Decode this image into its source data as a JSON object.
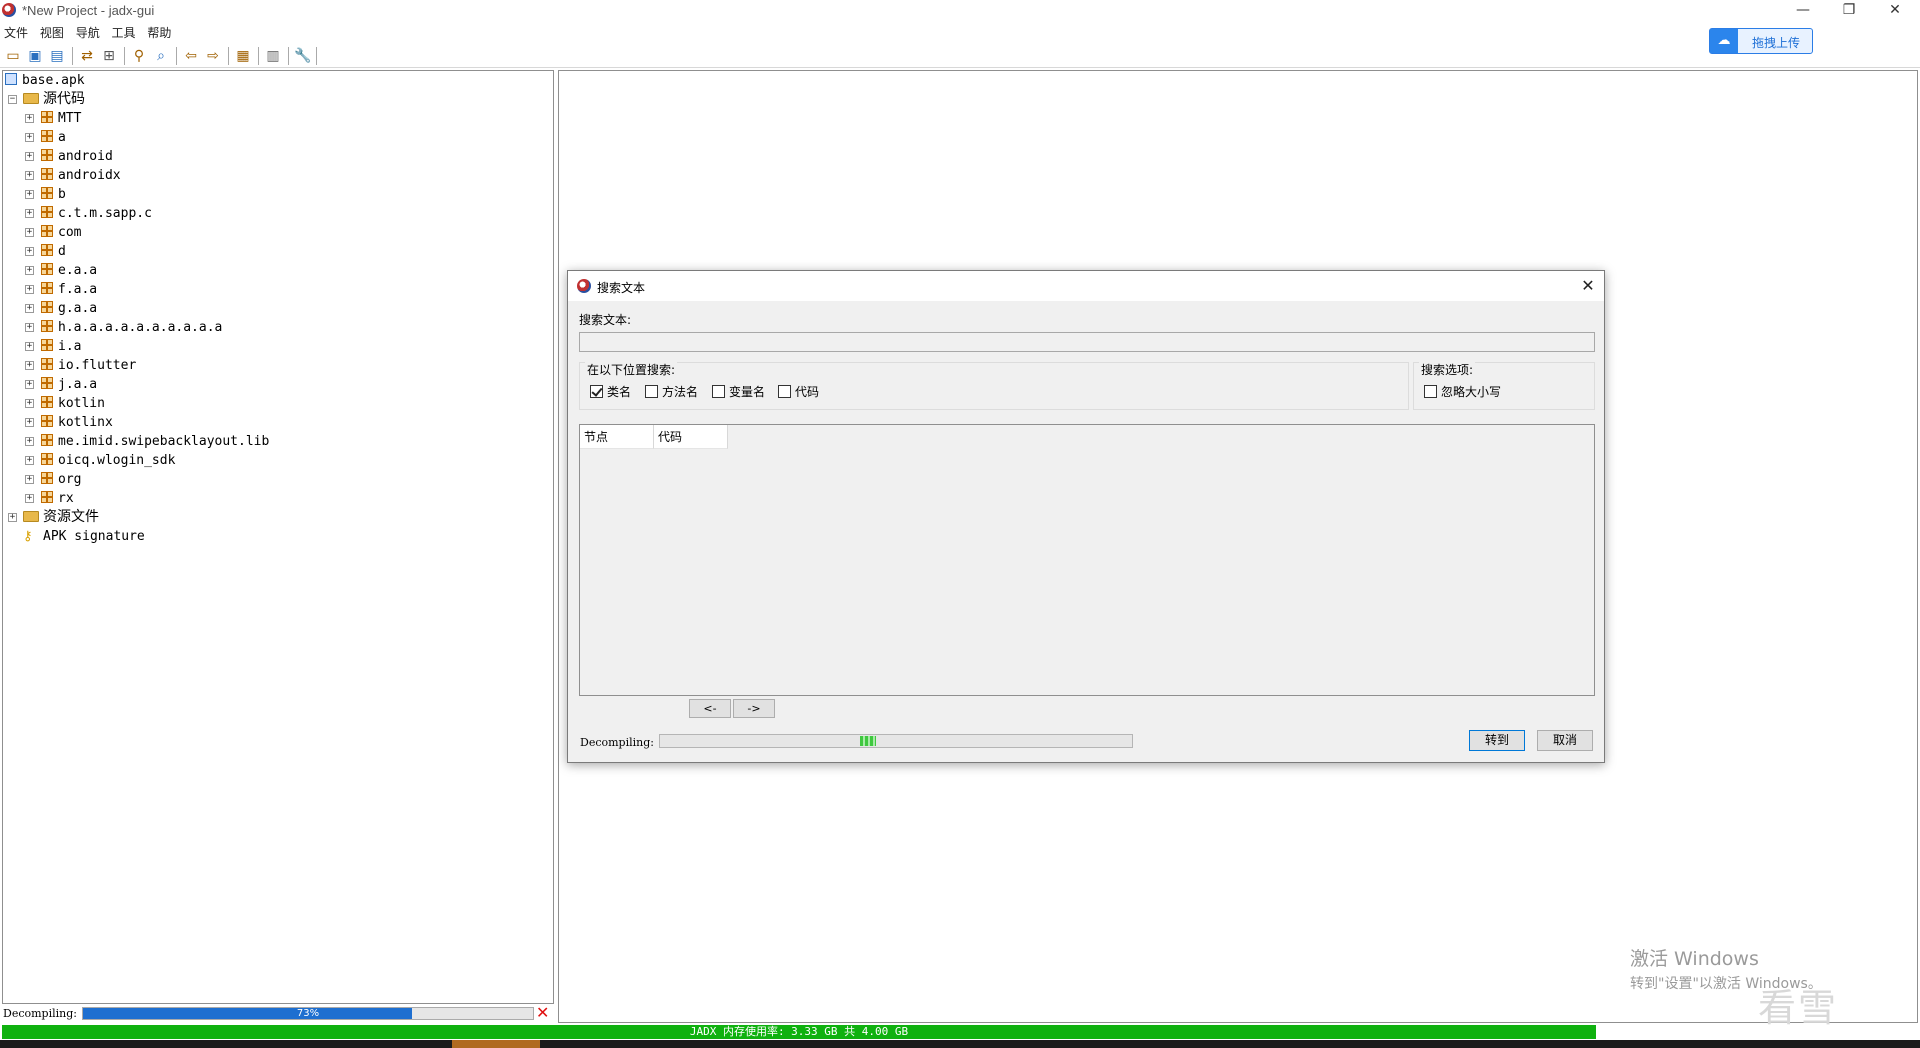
{
  "window": {
    "title": "*New Project - jadx-gui",
    "min_glyph": "—",
    "max_glyph": "❐",
    "close_glyph": "✕",
    "upload_button": "拖拽上传"
  },
  "menu": [
    "文件",
    "视图",
    "导航",
    "工具",
    "帮助"
  ],
  "toolbar_icons": [
    "open-folder-icon",
    "save-icon",
    "save-all-icon",
    "sync-icon",
    "flatten-packages-icon",
    "search-text-icon",
    "find-class-icon",
    "back-icon",
    "forward-icon",
    "deobfuscation-icon",
    "log-icon",
    "preferences-icon"
  ],
  "tree": {
    "root": "base.apk",
    "source_folder": "源代码",
    "packages": [
      "MTT",
      "a",
      "android",
      "androidx",
      "b",
      "c.t.m.sapp.c",
      "com",
      "d",
      "e.a.a",
      "f.a.a",
      "g.a.a",
      "h.a.a.a.a.a.a.a.a.a.a",
      "i.a",
      "io.flutter",
      "j.a.a",
      "kotlin",
      "kotlinx",
      "me.imid.swipebacklayout.lib",
      "oicq.wlogin_sdk",
      "org",
      "rx"
    ],
    "resources_folder": "资源文件",
    "signature": "APK signature"
  },
  "left_status": {
    "label": "Decompiling:",
    "progress_text": "73%",
    "progress": 0.73
  },
  "memory_bar": "JADX 内存使用率: 3.33 GB 共 4.00 GB",
  "watermark": {
    "line1": "激活 Windows",
    "line2": "转到\"设置\"以激活 Windows。",
    "brand": "看雪"
  },
  "dialog": {
    "title": "搜索文本",
    "search_label": "搜索文本:",
    "search_value": "",
    "search_in": {
      "title": "在以下位置搜索:",
      "options": [
        {
          "label": "类名",
          "checked": true
        },
        {
          "label": "方法名",
          "checked": false
        },
        {
          "label": "变量名",
          "checked": false
        },
        {
          "label": "代码",
          "checked": false
        }
      ]
    },
    "search_options": {
      "title": "搜索选项:",
      "options": [
        {
          "label": "忽略大小写",
          "checked": false
        }
      ]
    },
    "columns": [
      "节点",
      "代码"
    ],
    "prev_page": "<-",
    "next_page": "->",
    "status_label": "Decompiling:",
    "goto_button": "转到",
    "cancel_button": "取消"
  },
  "colors": {
    "memory_bar": "#0fb10f",
    "progress_blue": "#1e6fd0",
    "accent_blue": "#0078d7"
  }
}
